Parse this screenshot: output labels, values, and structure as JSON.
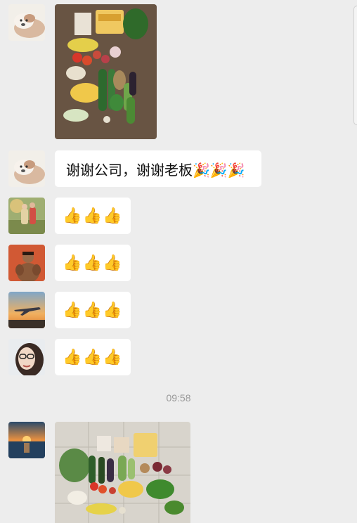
{
  "messages": [
    {
      "type": "image",
      "avatar": "puppy-avatar",
      "image": "vegetables-on-wood-floor"
    },
    {
      "type": "text",
      "avatar": "puppy-avatar",
      "text": "谢谢公司，谢谢老板🎉🎉🎉"
    },
    {
      "type": "emoji",
      "avatar": "couple-outdoor-avatar",
      "text": "👍👍👍"
    },
    {
      "type": "emoji",
      "avatar": "muscle-man-avatar",
      "text": "👍👍👍"
    },
    {
      "type": "emoji",
      "avatar": "jet-sunset-avatar",
      "text": "👍👍👍"
    },
    {
      "type": "emoji",
      "avatar": "woman-portrait-avatar",
      "text": "👍👍👍"
    },
    {
      "type": "image",
      "avatar": "sunset-sea-avatar",
      "image": "vegetables-on-tile-floor"
    }
  ],
  "timestamp": "09:58",
  "colors": {
    "background": "#ededed",
    "bubble": "#ffffff",
    "timestamp": "#999999"
  }
}
